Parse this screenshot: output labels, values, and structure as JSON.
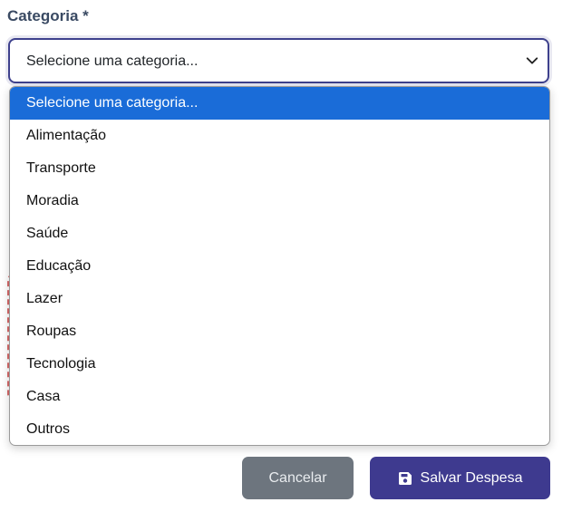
{
  "form": {
    "category_label": "Categoria *",
    "selected_value": "Selecione uma categoria..."
  },
  "dropdown": {
    "options": [
      "Selecione uma categoria...",
      "Alimentação",
      "Transporte",
      "Moradia",
      "Saúde",
      "Educação",
      "Lazer",
      "Roupas",
      "Tecnologia",
      "Casa",
      "Outros"
    ],
    "selected_index": 0
  },
  "actions": {
    "cancel_label": "Cancelar",
    "save_label": "Salvar Despesa",
    "save_icon": "floppy-disk-icon"
  },
  "colors": {
    "accent": "#3e3a8f",
    "highlight": "#1a6cd8",
    "cancel": "#6d757e"
  }
}
